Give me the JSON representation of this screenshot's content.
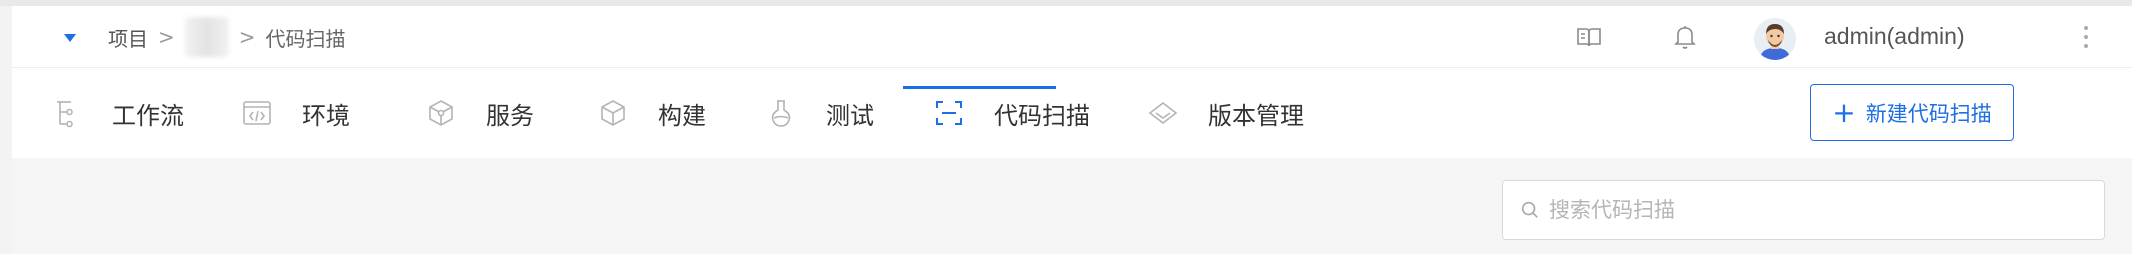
{
  "header": {
    "breadcrumb": {
      "root": "项目",
      "sep1": ">",
      "sep2": ">",
      "current": "代码扫描"
    },
    "icons": [
      "collapse-icon",
      "book-icon",
      "bell-icon",
      "avatar",
      "more-icon"
    ],
    "user": "admin(admin)"
  },
  "tabs": [
    {
      "label": "工作流",
      "icon": "workflow-icon"
    },
    {
      "label": "环境",
      "icon": "environment-icon"
    },
    {
      "label": "服务",
      "icon": "service-icon"
    },
    {
      "label": "构建",
      "icon": "build-icon"
    },
    {
      "label": "测试",
      "icon": "test-icon"
    },
    {
      "label": "代码扫描",
      "icon": "code-scan-icon",
      "active": true
    },
    {
      "label": "版本管理",
      "icon": "version-icon"
    }
  ],
  "actions": {
    "new_label": "新建代码扫描",
    "new_icon": "+"
  },
  "search": {
    "placeholder": "搜索代码扫描",
    "value": ""
  },
  "colors": {
    "accent": "#1e6fe3",
    "background": "#f5f5f5",
    "surface": "#ffffff"
  }
}
